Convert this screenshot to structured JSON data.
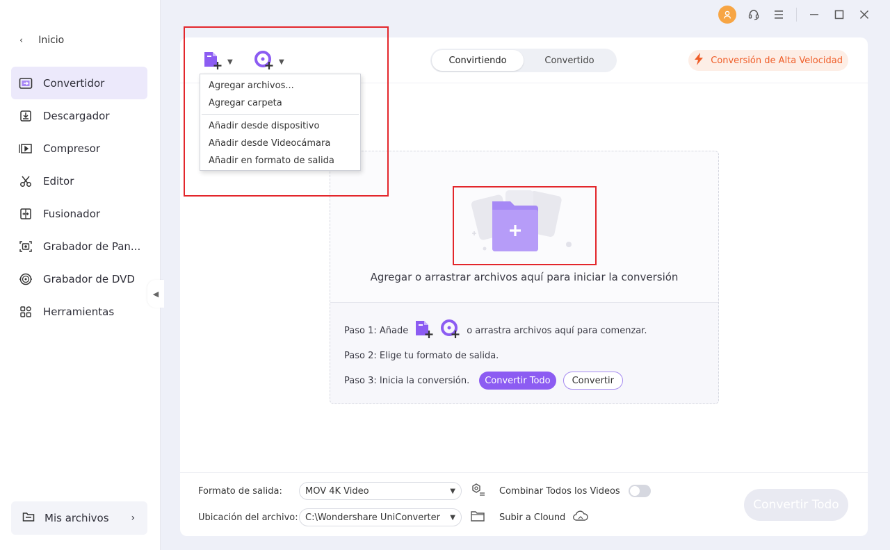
{
  "sidebar": {
    "home_label": "Inicio",
    "items": [
      {
        "label": "Convertidor",
        "icon": "converter-icon",
        "active": true
      },
      {
        "label": "Descargador",
        "icon": "downloader-icon",
        "active": false
      },
      {
        "label": "Compresor",
        "icon": "compressor-icon",
        "active": false
      },
      {
        "label": "Editor",
        "icon": "scissors-icon",
        "active": false
      },
      {
        "label": "Fusionador",
        "icon": "merger-icon",
        "active": false
      },
      {
        "label": "Grabador de Pan...",
        "icon": "screen-recorder-icon",
        "active": false
      },
      {
        "label": "Grabador de DVD",
        "icon": "dvd-icon",
        "active": false
      },
      {
        "label": "Herramientas",
        "icon": "tools-grid-icon",
        "active": false
      }
    ],
    "my_files_label": "Mis archivos"
  },
  "header": {
    "tabs": [
      {
        "label": "Convirtiendo",
        "active": true
      },
      {
        "label": "Convertido",
        "active": false
      }
    ],
    "high_speed_label": "Conversión de Alta Velocidad"
  },
  "add_menu": {
    "items": [
      "Agregar archivos...",
      "Agregar carpeta",
      "Añadir desde dispositivo",
      "Añadir desde Videocámara",
      "Añadir en formato de salida"
    ]
  },
  "dropzone": {
    "text": "Agregar o arrastrar archivos aquí para iniciar la conversión",
    "step1_prefix": "Paso 1: Añade",
    "step1_suffix": "o arrastra archivos aquí para comenzar.",
    "step2": "Paso 2: Elige tu formato de salida.",
    "step3": "Paso 3: Inicia la conversión.",
    "convert_all_label": "Convertir Todo",
    "convert_label": "Convertir"
  },
  "bottom": {
    "output_format_label": "Formato de salida:",
    "output_format_value": "MOV 4K Video",
    "merge_label": "Combinar Todos los Videos",
    "merge_enabled": false,
    "location_label": "Ubicación del archivo:",
    "location_value": "C:\\Wondershare UniConverter",
    "upload_label": "Subir a Clound",
    "convert_all_label": "Convertir Todo"
  },
  "colors": {
    "accent": "#8c5cf2",
    "highlight_box": "#e3262b",
    "high_speed_text": "#ef5d28",
    "avatar": "#f7a544"
  }
}
